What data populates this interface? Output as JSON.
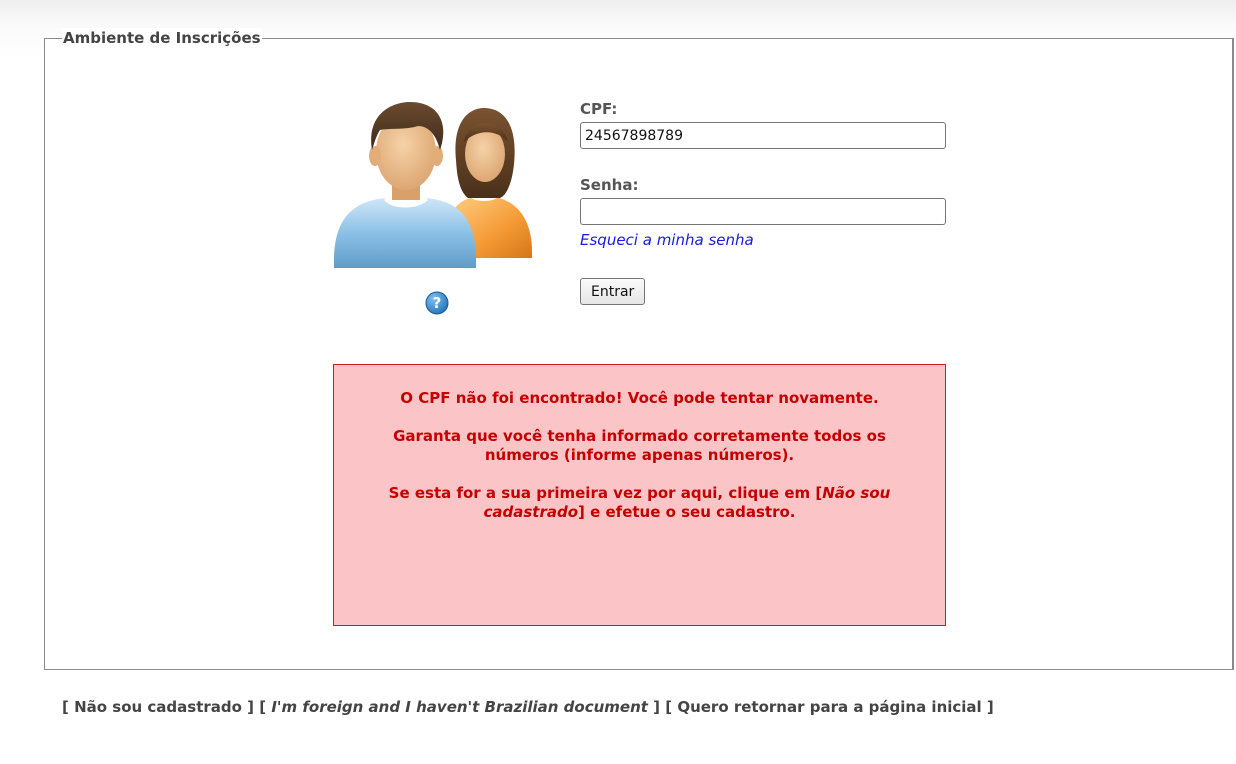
{
  "fieldset": {
    "legend": "Ambiente de Inscrições"
  },
  "icons": {
    "avatar": "users-avatar-icon",
    "help": "help-question-icon"
  },
  "login": {
    "cpf_label": "CPF:",
    "cpf_value": "24567898789",
    "senha_label": "Senha:",
    "senha_value": "",
    "forgot_link": "Esqueci a minha senha",
    "submit_label": "Entrar"
  },
  "error": {
    "line1": "O CPF não foi encontrado! Você pode tentar novamente.",
    "line2": "Garanta que você tenha informado corretamente todos os números (informe apenas números).",
    "line3_before": "Se esta for a sua primeira vez por aqui, clique em [",
    "line3_em": "Não sou cadastrado",
    "line3_after": "] e efetue o seu cadastro."
  },
  "footer": {
    "link1": "Não sou cadastrado",
    "link2": "I'm foreign and I haven't Brazilian document",
    "link3": "Quero retornar para a página inicial"
  },
  "colors": {
    "error_bg": "#fbc5c8",
    "error_border": "#d21a1a",
    "error_text": "#c40000",
    "link": "#1a1ae6"
  }
}
